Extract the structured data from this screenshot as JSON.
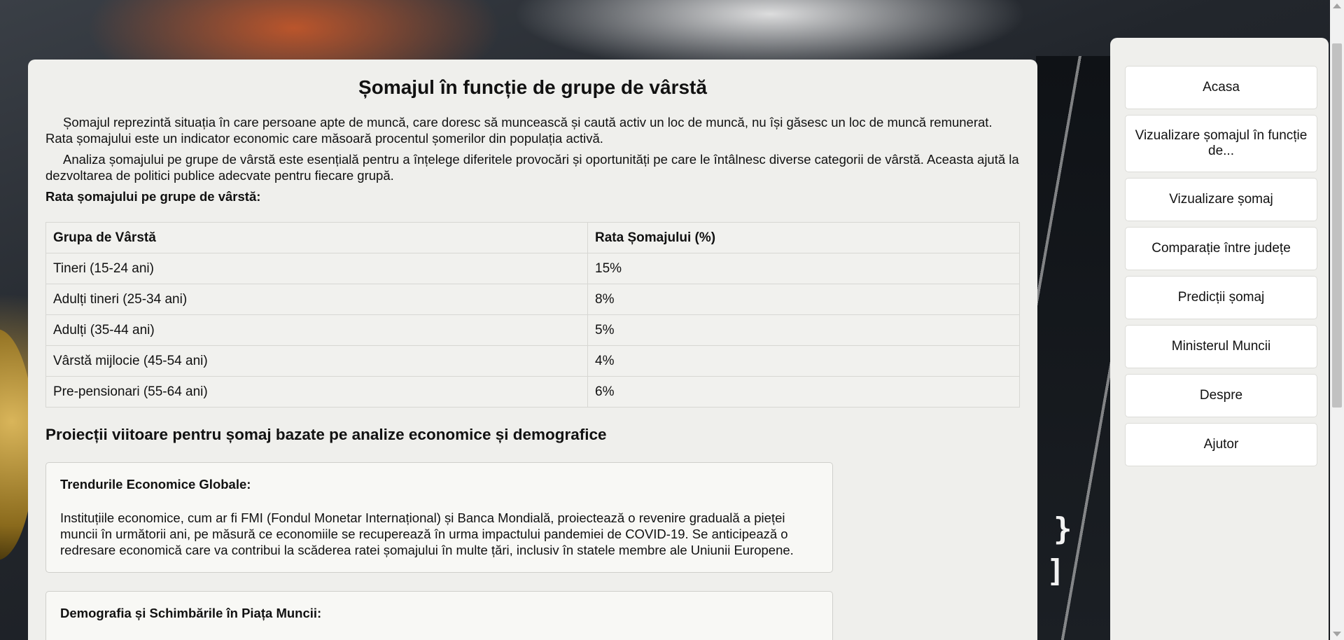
{
  "page": {
    "title": "Șomajul în funcție de grupe de vârstă",
    "paragraphs": [
      "Șomajul reprezintă situația în care persoane apte de muncă, care doresc să muncească și caută activ un loc de muncă, nu își găsesc un loc de muncă remunerat. Rata șomajului este un indicator economic care măsoară procentul șomerilor din populația activă.",
      "Analiza șomajului pe grupe de vârstă este esențială pentru a înțelege diferitele provocări și oportunități pe care le întâlnesc diverse categorii de vârstă. Aceasta ajută la dezvoltarea de politici publice adecvate pentru fiecare grupă."
    ],
    "table_label": "Rata șomajului pe grupe de vârstă:"
  },
  "table": {
    "headers": [
      "Grupa de Vârstă",
      "Rata Șomajului (%)"
    ],
    "rows": [
      [
        "Tineri (15-24 ani)",
        "15%"
      ],
      [
        "Adulți tineri (25-34 ani)",
        "8%"
      ],
      [
        "Adulți (35-44 ani)",
        "5%"
      ],
      [
        "Vârstă mijlocie (45-54 ani)",
        "4%"
      ],
      [
        "Pre-pensionari (55-64 ani)",
        "6%"
      ]
    ]
  },
  "projections": {
    "title": "Proiecții viitoare pentru șomaj bazate pe analize economice și demografice",
    "cards": [
      {
        "heading": "Trendurile Economice Globale:",
        "text": "Instituțiile economice, cum ar fi FMI (Fondul Monetar Internațional) și Banca Mondială, proiectează o revenire graduală a pieței muncii în următorii ani, pe măsură ce economiile se recuperează în urma impactului pandemiei de COVID-19. Se anticipează o redresare economică care va contribui la scăderea ratei șomajului în multe țări, inclusiv în statele membre ale Uniunii Europene."
      },
      {
        "heading": "Demografia și Schimbările în Piața Muncii:",
        "text": ""
      }
    ]
  },
  "sidebar": {
    "items": [
      {
        "label": "Acasa"
      },
      {
        "label": "Vizualizare șomajul în funcție de..."
      },
      {
        "label": "Vizualizare șomaj"
      },
      {
        "label": "Comparație între județe"
      },
      {
        "label": "Predicții șomaj"
      },
      {
        "label": "Ministerul Muncii"
      },
      {
        "label": "Despre"
      },
      {
        "label": "Ajutor"
      }
    ]
  },
  "background": {
    "glyphs": [
      "}",
      "]"
    ]
  }
}
